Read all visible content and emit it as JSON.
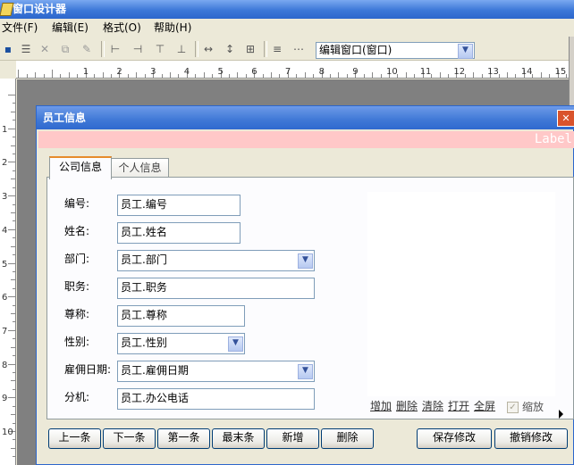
{
  "app": {
    "title": "窗口设计器"
  },
  "menu": [
    "文件(F)",
    "编辑(E)",
    "格式(O)",
    "帮助(H)"
  ],
  "toolbar": {
    "combo_value": "编辑窗口(窗口)"
  },
  "ruler": {
    "h_labels": [
      "1",
      "2",
      "3",
      "4",
      "5",
      "6",
      "7",
      "8",
      "9",
      "10",
      "11",
      "12",
      "13",
      "14",
      "15"
    ],
    "v_labels": [
      "1",
      "2",
      "3",
      "4",
      "5",
      "6",
      "7",
      "8",
      "9",
      "10"
    ]
  },
  "form": {
    "title": "员工信息",
    "band_label": "Label",
    "tabs": [
      "公司信息",
      "个人信息"
    ],
    "fields": [
      {
        "label": "编号:",
        "value": "员工.编号"
      },
      {
        "label": "姓名:",
        "value": "员工.姓名"
      },
      {
        "label": "部门:",
        "value": "员工.部门"
      },
      {
        "label": "职务:",
        "value": "员工.职务"
      },
      {
        "label": "尊称:",
        "value": "员工.尊称"
      },
      {
        "label": "性别:",
        "value": "员工.性别"
      },
      {
        "label": "雇佣日期:",
        "value": "员工.雇佣日期"
      },
      {
        "label": "分机:",
        "value": "员工.办公电话"
      }
    ],
    "image_links": [
      "增加",
      "删除",
      "清除",
      "打开",
      "全屏"
    ],
    "zoom_label": "缩放",
    "buttons": [
      "上一条",
      "下一条",
      "第一条",
      "最末条",
      "新增",
      "删除",
      "保存修改",
      "撤销修改"
    ]
  }
}
